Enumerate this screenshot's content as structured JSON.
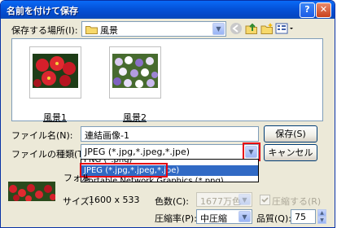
{
  "dialog": {
    "title": "名前を付けて保存",
    "help_label": "?",
    "close_label": "✕"
  },
  "location": {
    "label": "保存する場所(I):",
    "value": "風景"
  },
  "files": [
    {
      "name": "風景1"
    },
    {
      "name": "風景2"
    }
  ],
  "filename": {
    "label": "ファイル名(N):",
    "value": "連結画像-1"
  },
  "filetype": {
    "label": "ファイルの種類(T):",
    "value": "JPEG (*.jpg,*.jpeg,*.jpe)",
    "options": [
      "JPEG (*.jpg,*.jpeg,*.jpe)",
      "Portable Network Graphics (*.png)"
    ],
    "partial_above": "PNG (*.png)"
  },
  "buttons": {
    "save": "保存(S)",
    "cancel": "キャンセル"
  },
  "preview": {
    "folder_label_partial": "フォル",
    "size_label": "サイズ：",
    "size_value": "1600 x 533"
  },
  "colors": {
    "label": "色数(C):",
    "value": "1677万色"
  },
  "compress": {
    "label": "圧縮する(R)"
  },
  "compression_ratio": {
    "label": "圧縮率(P):",
    "value": "中圧縮"
  },
  "quality": {
    "label": "品質(Q):",
    "value": "75"
  },
  "accent": {
    "highlight": "#e60012",
    "selection": "#316ac5",
    "titlebar": "#0452d9"
  }
}
